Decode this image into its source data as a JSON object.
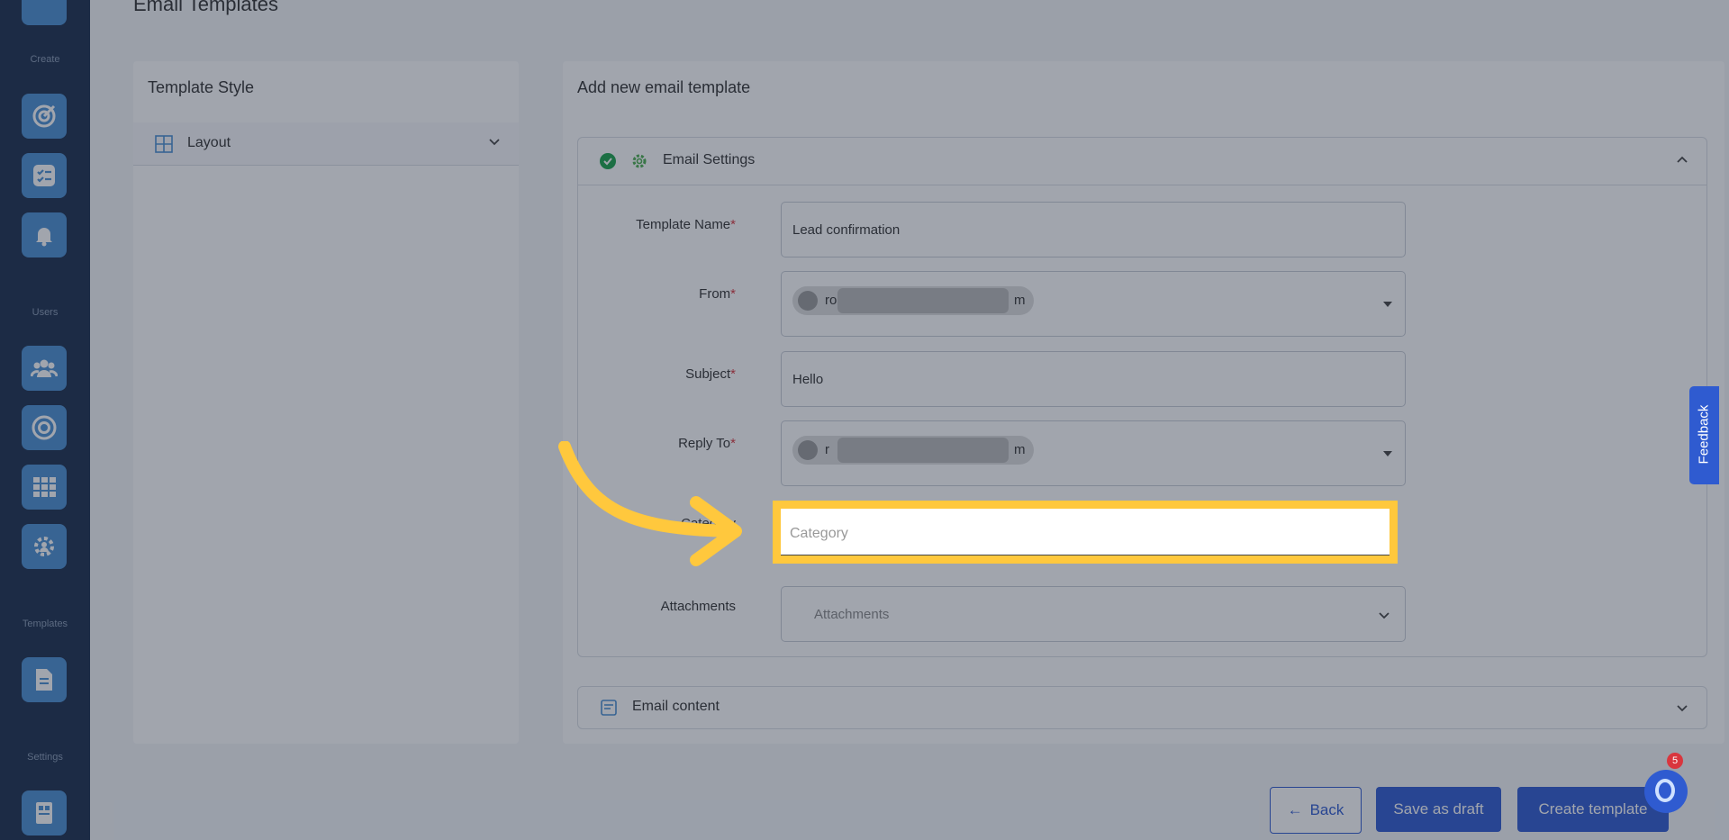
{
  "page": {
    "title": "Email Templates"
  },
  "sidebar": {
    "sections": [
      {
        "label": "Create",
        "items": [
          "target-icon",
          "checklist-icon",
          "bell-icon"
        ]
      },
      {
        "label": "Users",
        "items": [
          "users-icon",
          "circle-target-icon",
          "grid-icon",
          "team-gear-icon"
        ]
      },
      {
        "label": "Templates",
        "items": [
          "document-icon"
        ]
      },
      {
        "label": "Settings",
        "items": [
          "settings-doc-icon"
        ]
      }
    ]
  },
  "template_style": {
    "title": "Template Style",
    "layout_label": "Layout"
  },
  "form": {
    "title": "Add new email template",
    "settings_title": "Email Settings",
    "template_name_label": "Template Name",
    "template_name_value": "Lead confirmation",
    "from_label": "From",
    "from_value_start": "ro",
    "from_value_end": "m",
    "subject_label": "Subject",
    "subject_value": "Hello",
    "reply_to_label": "Reply To",
    "reply_to_value_start": "r",
    "reply_to_value_end": "m",
    "category_label": "Category",
    "category_placeholder": "Category",
    "attachments_label": "Attachments",
    "attachments_placeholder": "Attachments",
    "required_mark": "*",
    "content_title": "Email content"
  },
  "footer": {
    "back_label": "Back",
    "save_draft_label": "Save as draft",
    "create_label": "Create template"
  },
  "help": {
    "badge_count": "5"
  },
  "feedback_label": "Feedback",
  "colors": {
    "accent": "#2f5bd0",
    "highlight": "#ffc83d",
    "sidebar": "#1a2e4d",
    "success": "#1aa34a"
  }
}
